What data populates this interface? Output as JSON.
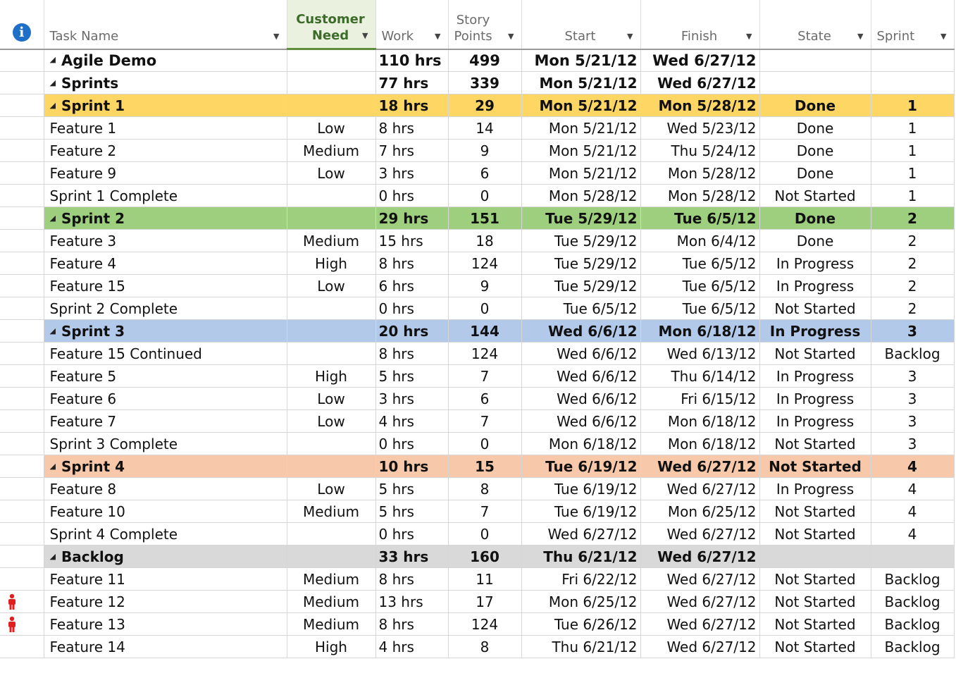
{
  "header": {
    "info_icon": "info-icon",
    "task": "Task Name",
    "need": "Customer\nNeed",
    "work": "Work",
    "points": "Story\nPoints",
    "start": "Start",
    "finish": "Finish",
    "state": "State",
    "sprint": "Sprint"
  },
  "colors": {
    "sprint1": "#fdd663",
    "sprint2": "#9dcf7e",
    "sprint3": "#b3c9e9",
    "sprint4": "#f7c8a9",
    "backlog": "#d9d9d9",
    "info": "#1f6fc9",
    "person": "#e02020"
  },
  "rows": [
    {
      "task": "Agile Demo",
      "need": "",
      "work": "110 hrs",
      "points": "499",
      "start": "Mon 5/21/12",
      "finish": "Wed 6/27/12",
      "state": "",
      "sprint": ""
    },
    {
      "task": "Sprints",
      "need": "",
      "work": "77 hrs",
      "points": "339",
      "start": "Mon 5/21/12",
      "finish": "Wed 6/27/12",
      "state": "",
      "sprint": ""
    },
    {
      "task": "Sprint 1",
      "need": "",
      "work": "18 hrs",
      "points": "29",
      "start": "Mon 5/21/12",
      "finish": "Mon 5/28/12",
      "state": "Done",
      "sprint": "1"
    },
    {
      "task": "Feature 1",
      "need": "Low",
      "work": "8 hrs",
      "points": "14",
      "start": "Mon 5/21/12",
      "finish": "Wed 5/23/12",
      "state": "Done",
      "sprint": "1"
    },
    {
      "task": "Feature 2",
      "need": "Medium",
      "work": "7 hrs",
      "points": "9",
      "start": "Mon 5/21/12",
      "finish": "Thu 5/24/12",
      "state": "Done",
      "sprint": "1"
    },
    {
      "task": "Feature 9",
      "need": "Low",
      "work": "3 hrs",
      "points": "6",
      "start": "Mon 5/21/12",
      "finish": "Mon 5/28/12",
      "state": "Done",
      "sprint": "1"
    },
    {
      "task": "Sprint 1 Complete",
      "need": "",
      "work": "0 hrs",
      "points": "0",
      "start": "Mon 5/28/12",
      "finish": "Mon 5/28/12",
      "state": "Not Started",
      "sprint": "1"
    },
    {
      "task": "Sprint 2",
      "need": "",
      "work": "29 hrs",
      "points": "151",
      "start": "Tue 5/29/12",
      "finish": "Tue 6/5/12",
      "state": "Done",
      "sprint": "2"
    },
    {
      "task": "Feature 3",
      "need": "Medium",
      "work": "15 hrs",
      "points": "18",
      "start": "Tue 5/29/12",
      "finish": "Mon 6/4/12",
      "state": "Done",
      "sprint": "2"
    },
    {
      "task": "Feature 4",
      "need": "High",
      "work": "8 hrs",
      "points": "124",
      "start": "Tue 5/29/12",
      "finish": "Tue 6/5/12",
      "state": "In Progress",
      "sprint": "2"
    },
    {
      "task": "Feature 15",
      "need": "Low",
      "work": "6 hrs",
      "points": "9",
      "start": "Tue 5/29/12",
      "finish": "Tue 6/5/12",
      "state": "In Progress",
      "sprint": "2"
    },
    {
      "task": "Sprint 2 Complete",
      "need": "",
      "work": "0 hrs",
      "points": "0",
      "start": "Tue 6/5/12",
      "finish": "Tue 6/5/12",
      "state": "Not Started",
      "sprint": "2"
    },
    {
      "task": "Sprint 3",
      "need": "",
      "work": "20 hrs",
      "points": "144",
      "start": "Wed 6/6/12",
      "finish": "Mon 6/18/12",
      "state": "In Progress",
      "sprint": "3"
    },
    {
      "task": "Feature 15 Continued",
      "need": "",
      "work": "8 hrs",
      "points": "124",
      "start": "Wed 6/6/12",
      "finish": "Wed 6/13/12",
      "state": "Not Started",
      "sprint": "Backlog"
    },
    {
      "task": "Feature 5",
      "need": "High",
      "work": "5 hrs",
      "points": "7",
      "start": "Wed 6/6/12",
      "finish": "Thu 6/14/12",
      "state": "In Progress",
      "sprint": "3"
    },
    {
      "task": "Feature 6",
      "need": "Low",
      "work": "3 hrs",
      "points": "6",
      "start": "Wed 6/6/12",
      "finish": "Fri 6/15/12",
      "state": "In Progress",
      "sprint": "3"
    },
    {
      "task": "Feature 7",
      "need": "Low",
      "work": "4 hrs",
      "points": "7",
      "start": "Wed 6/6/12",
      "finish": "Mon 6/18/12",
      "state": "In Progress",
      "sprint": "3"
    },
    {
      "task": "Sprint 3 Complete",
      "need": "",
      "work": "0 hrs",
      "points": "0",
      "start": "Mon 6/18/12",
      "finish": "Mon 6/18/12",
      "state": "Not Started",
      "sprint": "3"
    },
    {
      "task": "Sprint 4",
      "need": "",
      "work": "10 hrs",
      "points": "15",
      "start": "Tue 6/19/12",
      "finish": "Wed 6/27/12",
      "state": "Not Started",
      "sprint": "4"
    },
    {
      "task": "Feature 8",
      "need": "Low",
      "work": "5 hrs",
      "points": "8",
      "start": "Tue 6/19/12",
      "finish": "Wed 6/27/12",
      "state": "In Progress",
      "sprint": "4"
    },
    {
      "task": "Feature 10",
      "need": "Medium",
      "work": "5 hrs",
      "points": "7",
      "start": "Tue 6/19/12",
      "finish": "Mon 6/25/12",
      "state": "Not Started",
      "sprint": "4"
    },
    {
      "task": "Sprint 4 Complete",
      "need": "",
      "work": "0 hrs",
      "points": "0",
      "start": "Wed 6/27/12",
      "finish": "Wed 6/27/12",
      "state": "Not Started",
      "sprint": "4"
    },
    {
      "task": "Backlog",
      "need": "",
      "work": "33 hrs",
      "points": "160",
      "start": "Thu 6/21/12",
      "finish": "Wed 6/27/12",
      "state": "",
      "sprint": ""
    },
    {
      "task": "Feature 11",
      "need": "Medium",
      "work": "8 hrs",
      "points": "11",
      "start": "Fri 6/22/12",
      "finish": "Wed 6/27/12",
      "state": "Not Started",
      "sprint": "Backlog"
    },
    {
      "task": "Feature 12",
      "need": "Medium",
      "work": "13 hrs",
      "points": "17",
      "start": "Mon 6/25/12",
      "finish": "Wed 6/27/12",
      "state": "Not Started",
      "sprint": "Backlog",
      "indicator": "person-icon"
    },
    {
      "task": "Feature 13",
      "need": "Medium",
      "work": "8 hrs",
      "points": "124",
      "start": "Tue 6/26/12",
      "finish": "Wed 6/27/12",
      "state": "Not Started",
      "sprint": "Backlog",
      "indicator": "person-icon"
    },
    {
      "task": "Feature 14",
      "need": "High",
      "work": "4 hrs",
      "points": "8",
      "start": "Thu 6/21/12",
      "finish": "Wed 6/27/12",
      "state": "Not Started",
      "sprint": "Backlog"
    }
  ]
}
